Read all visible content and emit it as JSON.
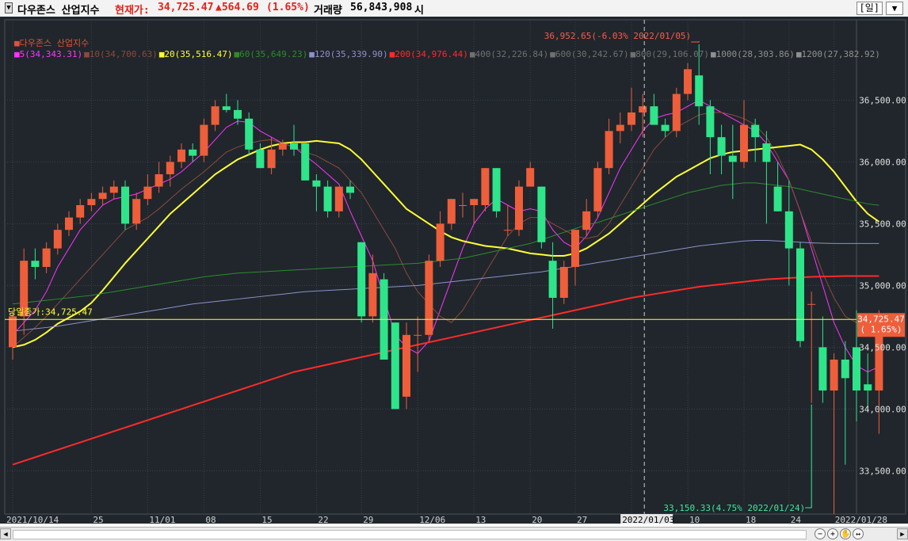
{
  "header": {
    "name": "다우존스 산업지수",
    "price_label": "현재가:",
    "price": "34,725.47",
    "change": "▲564.69",
    "change_pct": "(1.65%)",
    "volume_label": "거래량",
    "volume": "56,843,908",
    "unit": "시",
    "period_button": "[일]",
    "menu_button": "▼"
  },
  "legend": [
    {
      "text": "다우존스 산업지수",
      "color": "#e0533c"
    },
    {
      "text": "5(34,343.31)",
      "color": "#ff33ff"
    },
    {
      "text": "10(34,700.63)",
      "color": "#8c4a3c"
    },
    {
      "text": "20(35,516.47)",
      "color": "#ffff33"
    },
    {
      "text": "60(35,649.23)",
      "color": "#2e8b2e"
    },
    {
      "text": "120(35,339.90)",
      "color": "#9090c8"
    },
    {
      "text": "200(34,976.44)",
      "color": "#ff2a2a"
    },
    {
      "text": "400(32,226.84)",
      "color": "#707070"
    },
    {
      "text": "600(30,242.67)",
      "color": "#707070"
    },
    {
      "text": "800(29,106.07)",
      "color": "#707070"
    },
    {
      "text": "1000(28,303.86)",
      "color": "#909090"
    },
    {
      "text": "1200(27,382.92)",
      "color": "#909090"
    }
  ],
  "annotations": {
    "prev_close": "당일종가:34,725.47",
    "high": "36,952.65(-6.03% 2022/01/05)",
    "low": "33,150.33(4.75% 2022/01/24)",
    "last_price": "34,725.47",
    "last_pct": "( 1.65%)",
    "cursor_date": "2022/01/03"
  },
  "colors": {
    "up": "#ee5e3a",
    "down": "#2ee58a",
    "background": "#20262c",
    "grid": "#3e464e",
    "price_line": "#ffff33"
  },
  "chart_data": {
    "type": "candlestick",
    "y_range": [
      33150,
      37150
    ],
    "y_ticks": [
      "36,500.00",
      "36,000.00",
      "35,500.00",
      "35,000.00",
      "34,500.00",
      "34,000.00",
      "33,500.00"
    ],
    "y_tick_values": [
      36500,
      36000,
      35500,
      35000,
      34500,
      34000,
      33500
    ],
    "x_ticks": [
      {
        "label": "2021/10/14",
        "i": 0
      },
      {
        "label": "25",
        "i": 7
      },
      {
        "label": "11/01",
        "i": 12
      },
      {
        "label": "08",
        "i": 17
      },
      {
        "label": "15",
        "i": 22
      },
      {
        "label": "22",
        "i": 27
      },
      {
        "label": "29",
        "i": 31
      },
      {
        "label": "12/06",
        "i": 36
      },
      {
        "label": "13",
        "i": 41
      },
      {
        "label": "20",
        "i": 46
      },
      {
        "label": "27",
        "i": 50
      },
      {
        "label": "03",
        "i": 55
      },
      {
        "label": "10",
        "i": 60
      },
      {
        "label": "18",
        "i": 65
      },
      {
        "label": "24",
        "i": 69
      },
      {
        "label": "2022/01/28",
        "i": 73
      }
    ],
    "candles": [
      [
        34500,
        34800,
        34400,
        34750
      ],
      [
        34750,
        35300,
        34600,
        35200
      ],
      [
        35200,
        35300,
        35050,
        35150
      ],
      [
        35150,
        35350,
        35100,
        35300
      ],
      [
        35300,
        35500,
        35250,
        35450
      ],
      [
        35450,
        35600,
        35400,
        35550
      ],
      [
        35550,
        35700,
        35500,
        35650
      ],
      [
        35650,
        35750,
        35600,
        35700
      ],
      [
        35700,
        35800,
        35650,
        35750
      ],
      [
        35750,
        35850,
        35700,
        35800
      ],
      [
        35800,
        35850,
        35450,
        35500
      ],
      [
        35500,
        35750,
        35450,
        35700
      ],
      [
        35700,
        35900,
        35650,
        35800
      ],
      [
        35800,
        36000,
        35750,
        35900
      ],
      [
        35900,
        36050,
        35800,
        36000
      ],
      [
        36000,
        36150,
        35950,
        36100
      ],
      [
        36100,
        36150,
        36000,
        36050
      ],
      [
        36050,
        36350,
        36000,
        36300
      ],
      [
        36300,
        36500,
        36250,
        36450
      ],
      [
        36450,
        36550,
        36400,
        36420
      ],
      [
        36420,
        36500,
        36300,
        36350
      ],
      [
        36350,
        36400,
        36050,
        36100
      ],
      [
        36100,
        36150,
        35950,
        35950
      ],
      [
        35950,
        36200,
        35900,
        36100
      ],
      [
        36100,
        36180,
        36050,
        36150
      ],
      [
        36150,
        36300,
        36050,
        36100
      ],
      [
        36150,
        36150,
        35850,
        35850
      ],
      [
        35850,
        35900,
        35600,
        35800
      ],
      [
        35800,
        35850,
        35550,
        35600
      ],
      [
        35600,
        35800,
        35550,
        35800
      ],
      [
        35800,
        35850,
        35700,
        35750
      ],
      [
        35350,
        35350,
        34700,
        34750
      ],
      [
        34750,
        35250,
        34700,
        35100
      ],
      [
        35050,
        35100,
        34400,
        34400
      ],
      [
        34700,
        34700,
        34000,
        34000
      ],
      [
        34100,
        34700,
        34000,
        34600
      ],
      [
        34600,
        34750,
        34300,
        34600
      ],
      [
        34600,
        35250,
        34550,
        35200
      ],
      [
        35200,
        35600,
        35150,
        35500
      ],
      [
        35500,
        35700,
        35450,
        35700
      ],
      [
        35650,
        35750,
        35550,
        35650
      ],
      [
        35650,
        35700,
        35500,
        35700
      ],
      [
        35650,
        35950,
        35600,
        35950
      ],
      [
        35950,
        35950,
        35550,
        35600
      ],
      [
        35450,
        35650,
        35400,
        35450
      ],
      [
        35450,
        35850,
        35400,
        35800
      ],
      [
        35800,
        36000,
        35800,
        35950
      ],
      [
        35800,
        35800,
        35300,
        35350
      ],
      [
        35200,
        35350,
        34650,
        34900
      ],
      [
        34900,
        35200,
        34850,
        35150
      ],
      [
        35150,
        35450,
        35000,
        35450
      ],
      [
        35450,
        35700,
        35400,
        35600
      ],
      [
        35600,
        36000,
        35550,
        35950
      ],
      [
        35950,
        36350,
        35900,
        36250
      ],
      [
        36250,
        36400,
        36150,
        36300
      ],
      [
        36300,
        36600,
        36250,
        36400
      ],
      [
        36400,
        36550,
        36200,
        36450
      ],
      [
        36450,
        36550,
        36300,
        36300
      ],
      [
        36300,
        36350,
        36200,
        36250
      ],
      [
        36250,
        36600,
        36200,
        36550
      ],
      [
        36550,
        36800,
        36500,
        36750
      ],
      [
        36700,
        36952,
        36300,
        36450
      ],
      [
        36450,
        36500,
        35900,
        36200
      ],
      [
        36200,
        36300,
        35900,
        36050
      ],
      [
        36050,
        36300,
        35700,
        36000
      ],
      [
        36000,
        36500,
        35950,
        36300
      ],
      [
        36300,
        36350,
        36000,
        36200
      ],
      [
        36150,
        36250,
        35500,
        36000
      ],
      [
        35800,
        36000,
        35600,
        35600
      ],
      [
        35600,
        35850,
        35000,
        35300
      ],
      [
        35300,
        35350,
        34500,
        34550
      ],
      [
        34850,
        34950,
        34050,
        34850
      ],
      [
        34500,
        34750,
        34050,
        34150
      ],
      [
        34150,
        34450,
        33150,
        34400
      ],
      [
        34400,
        34550,
        33550,
        34250
      ],
      [
        34500,
        34800,
        33900,
        34150
      ],
      [
        34200,
        34450,
        34000,
        34150
      ],
      [
        34150,
        34800,
        33800,
        34725
      ]
    ],
    "series": [
      {
        "name": "5",
        "color": "#ff33ff",
        "values": [
          34600,
          34700,
          34800,
          34950,
          35150,
          35300,
          35450,
          35550,
          35650,
          35700,
          35720,
          35740,
          35780,
          35820,
          35860,
          35920,
          36000,
          36080,
          36180,
          36280,
          36330,
          36320,
          36250,
          36200,
          36150,
          36120,
          36050,
          35980,
          35900,
          35820,
          35600,
          35400,
          35200,
          34900,
          34600,
          34500,
          34450,
          34550,
          34800,
          35050,
          35300,
          35500,
          35620,
          35700,
          35650,
          35600,
          35620,
          35600,
          35450,
          35350,
          35300,
          35400,
          35550,
          35750,
          35950,
          36100,
          36250,
          36350,
          36380,
          36400,
          36450,
          36500,
          36450,
          36400,
          36350,
          36300,
          36250,
          36150,
          36000,
          35850,
          35600,
          35300,
          35000,
          34700,
          34500,
          34350,
          34300,
          34343
        ]
      },
      {
        "name": "10",
        "color": "#8c4a3c",
        "values": [
          34500,
          34580,
          34660,
          34750,
          34850,
          34950,
          35050,
          35150,
          35250,
          35350,
          35450,
          35500,
          35550,
          35620,
          35700,
          35780,
          35850,
          35920,
          36000,
          36080,
          36120,
          36150,
          36170,
          36180,
          36150,
          36120,
          36080,
          36050,
          36000,
          35950,
          35850,
          35750,
          35600,
          35450,
          35300,
          35100,
          34950,
          34850,
          34750,
          34700,
          34800,
          34950,
          35100,
          35250,
          35400,
          35500,
          35550,
          35550,
          35500,
          35450,
          35400,
          35380,
          35400,
          35500,
          35650,
          35800,
          35950,
          36100,
          36200,
          36280,
          36330,
          36380,
          36400,
          36400,
          36380,
          36350,
          36300,
          36200,
          36050,
          35850,
          35600,
          35350,
          35100,
          34900,
          34750,
          34700,
          34700,
          34700
        ]
      },
      {
        "name": "20",
        "color": "#ffff33",
        "values": [
          34500,
          34520,
          34560,
          34620,
          34690,
          34740,
          34790,
          34860,
          34960,
          35070,
          35180,
          35280,
          35380,
          35480,
          35580,
          35660,
          35740,
          35820,
          35900,
          35960,
          36020,
          36060,
          36100,
          36130,
          36150,
          36160,
          36160,
          36170,
          36160,
          36150,
          36100,
          36020,
          35920,
          35820,
          35720,
          35620,
          35560,
          35500,
          35440,
          35390,
          35360,
          35340,
          35320,
          35310,
          35300,
          35280,
          35260,
          35250,
          35240,
          35240,
          35260,
          35300,
          35360,
          35420,
          35500,
          35580,
          35660,
          35740,
          35810,
          35880,
          35930,
          35980,
          36030,
          36060,
          36080,
          36090,
          36100,
          36110,
          36120,
          36130,
          36140,
          36100,
          36020,
          35920,
          35800,
          35680,
          35580,
          35516
        ]
      },
      {
        "name": "60",
        "color": "#2e8b2e",
        "values": [
          34850,
          34860,
          34870,
          34880,
          34890,
          34900,
          34910,
          34920,
          34935,
          34950,
          34965,
          34980,
          34995,
          35010,
          35025,
          35040,
          35055,
          35070,
          35080,
          35090,
          35100,
          35105,
          35110,
          35115,
          35120,
          35125,
          35130,
          35135,
          35140,
          35145,
          35150,
          35155,
          35160,
          35165,
          35170,
          35175,
          35180,
          35190,
          35200,
          35210,
          35220,
          35240,
          35260,
          35280,
          35300,
          35320,
          35340,
          35370,
          35400,
          35430,
          35460,
          35490,
          35510,
          35540,
          35570,
          35600,
          35630,
          35660,
          35690,
          35720,
          35750,
          35770,
          35790,
          35810,
          35820,
          35830,
          35830,
          35820,
          35810,
          35800,
          35780,
          35760,
          35740,
          35720,
          35700,
          35680,
          35660,
          35649
        ]
      },
      {
        "name": "120",
        "color": "#9090c8",
        "values": [
          34630,
          34640,
          34650,
          34660,
          34670,
          34685,
          34700,
          34715,
          34730,
          34745,
          34760,
          34775,
          34790,
          34805,
          34820,
          34835,
          34850,
          34860,
          34870,
          34880,
          34890,
          34900,
          34910,
          34920,
          34930,
          34940,
          34950,
          34955,
          34960,
          34965,
          34970,
          34975,
          34980,
          34985,
          34990,
          34995,
          35000,
          35010,
          35020,
          35030,
          35040,
          35050,
          35060,
          35070,
          35080,
          35090,
          35100,
          35110,
          35125,
          35140,
          35155,
          35170,
          35185,
          35200,
          35215,
          35230,
          35245,
          35260,
          35275,
          35290,
          35305,
          35320,
          35330,
          35340,
          35350,
          35360,
          35365,
          35365,
          35360,
          35355,
          35350,
          35345,
          35342,
          35340,
          35340,
          35340,
          35340,
          35340
        ]
      },
      {
        "name": "200",
        "color": "#ff2a2a",
        "values": [
          33550,
          33580,
          33610,
          33640,
          33670,
          33700,
          33730,
          33760,
          33790,
          33820,
          33850,
          33880,
          33910,
          33940,
          33970,
          34000,
          34030,
          34060,
          34090,
          34120,
          34150,
          34180,
          34210,
          34240,
          34270,
          34300,
          34320,
          34340,
          34360,
          34380,
          34400,
          34420,
          34440,
          34460,
          34480,
          34500,
          34520,
          34540,
          34560,
          34580,
          34600,
          34620,
          34640,
          34660,
          34680,
          34700,
          34720,
          34740,
          34760,
          34780,
          34800,
          34820,
          34840,
          34860,
          34880,
          34900,
          34915,
          34930,
          34945,
          34960,
          34975,
          34990,
          35000,
          35010,
          35020,
          35030,
          35040,
          35050,
          35055,
          35060,
          35065,
          35070,
          35072,
          35074,
          35076,
          35076,
          35076,
          35076
        ]
      }
    ]
  }
}
